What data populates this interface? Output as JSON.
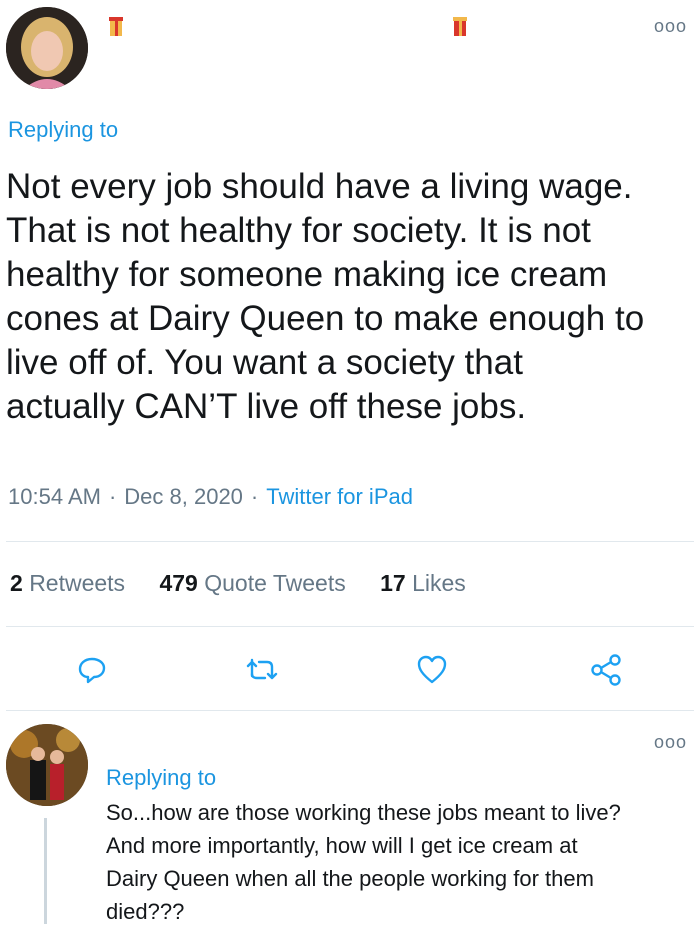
{
  "tweet": {
    "replying_to": "Replying to",
    "text": "Not every job should have a living wage.\nThat is not healthy for society. It is not\nhealthy for someone making ice cream\ncones at Dairy Queen to make enough to\nlive off of.  You want a society that\nactually CAN’T live off these jobs.",
    "time": "10:54 AM",
    "date": "Dec 8, 2020",
    "source": "Twitter for iPad",
    "separator": "·",
    "more_icon": "ooo"
  },
  "stats": {
    "retweets_count": "2",
    "retweets_label": "Retweets",
    "quotes_count": "479",
    "quotes_label": "Quote Tweets",
    "likes_count": "17",
    "likes_label": "Likes"
  },
  "actions": [
    "reply-icon",
    "retweet-icon",
    "like-icon",
    "share-icon"
  ],
  "reply": {
    "replying_to": "Replying to",
    "text": "So...how are those working these jobs meant to live?\nAnd more importantly, how will I get ice cream at\nDairy Queen when all the people working for them\ndied???",
    "more_icon": "ooo"
  },
  "colors": {
    "link": "#1b95e0",
    "muted": "#657786",
    "icon": "#1da1f2",
    "divider": "#e1e8ed"
  }
}
